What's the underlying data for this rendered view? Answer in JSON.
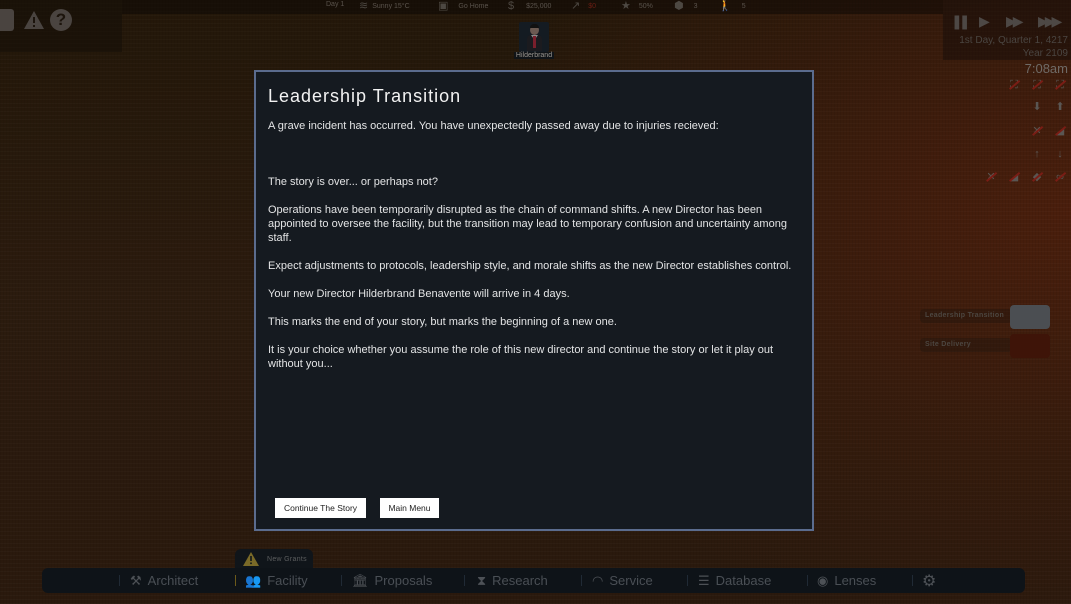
{
  "top_left": {
    "icons": [
      "save-icon",
      "warning-icon",
      "help-icon"
    ],
    "help_glyph": "?",
    "warning_glyph": "!"
  },
  "status_bar": {
    "day": "Day 1",
    "weather": "Sunny 15°C",
    "policy": "Go Home",
    "funds": "$25,000",
    "income": "$0",
    "rating": "50%",
    "security": "3",
    "staff": "5"
  },
  "portrait": {
    "name": "Hilderbrand"
  },
  "time_panel": {
    "speed_controls": [
      "pause",
      "play",
      "fast",
      "fastest"
    ],
    "date": "1st Day, Quarter 1, 4217",
    "year": "Year 2109",
    "clock": "7:08am"
  },
  "notifications": [
    {
      "label": "Leadership Transition",
      "color": "#4b4e52"
    },
    {
      "label": "Site Delivery",
      "color": "#3e1408"
    }
  ],
  "modal": {
    "title": "Leadership Transition",
    "paragraphs": {
      "p1": "A grave incident has occurred. You have unexpectedly passed away due to injuries recieved:",
      "p2": "The story is over... or perhaps not?",
      "p3": "Operations have been temporarily disrupted as the chain of command shifts. A new Director has been appointed to oversee the facility, but the transition may lead to temporary confusion and uncertainty among staff.",
      "p4": "Expect adjustments to protocols, leadership style, and morale shifts as the new Director establishes control.",
      "p5": "Your new Director  Hilderbrand Benavente will arrive in 4 days.",
      "p6": "This marks the end of your story, but marks the beginning of a new one.",
      "p7": "It is your choice whether you assume the role of this new director and continue the story or let it play out without you..."
    },
    "buttons": {
      "continue": "Continue The Story",
      "main_menu": "Main Menu"
    }
  },
  "bottom_nav": {
    "grants_tab": "New Grants",
    "items": [
      {
        "label": "Architect",
        "icon": "tools-icon"
      },
      {
        "label": "Facility",
        "icon": "people-icon"
      },
      {
        "label": "Proposals",
        "icon": "bank-icon"
      },
      {
        "label": "Research",
        "icon": "hourglass-icon"
      },
      {
        "label": "Service",
        "icon": "gauge-icon"
      },
      {
        "label": "Database",
        "icon": "database-icon"
      },
      {
        "label": "Lenses",
        "icon": "eye-icon"
      },
      {
        "label": "",
        "icon": "gear-icon"
      }
    ],
    "active": "Facility"
  }
}
